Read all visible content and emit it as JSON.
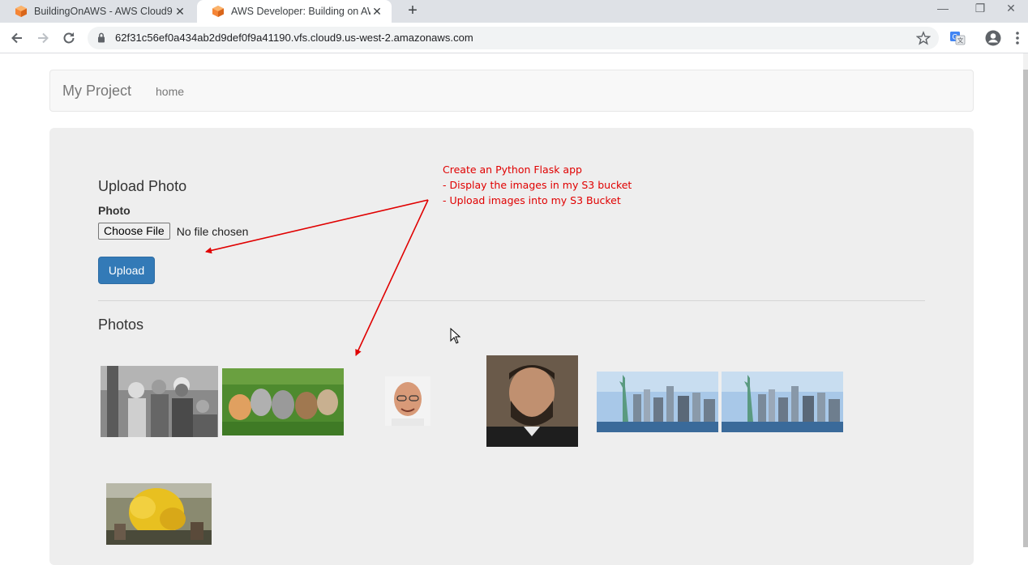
{
  "browser": {
    "tabs": [
      {
        "title": "BuildingOnAWS - AWS Cloud9",
        "active": false
      },
      {
        "title": "AWS Developer: Building on AWS",
        "active": true
      }
    ],
    "new_tab": "+",
    "url": "62f31c56ef0a434ab2d9def0f9a41190.vfs.cloud9.us-west-2.amazonaws.com"
  },
  "navbar": {
    "brand": "My Project",
    "links": [
      "home"
    ]
  },
  "upload": {
    "heading": "Upload Photo",
    "field_label": "Photo",
    "choose_button": "Choose File",
    "no_file": "No file chosen",
    "submit": "Upload"
  },
  "photos": {
    "heading": "Photos",
    "items": [
      {
        "subject": "historic group photo"
      },
      {
        "subject": "kittens on grass"
      },
      {
        "subject": "small portrait"
      },
      {
        "subject": "bearded man portrait"
      },
      {
        "subject": "statue of liberty skyline"
      },
      {
        "subject": "statue of liberty skyline"
      },
      {
        "subject": "yellow autumn tree"
      }
    ]
  },
  "annotation": {
    "line1": "Create an Python Flask app",
    "line2": "- Display the images in my S3 bucket",
    "line3": "- Upload images into my S3 Bucket",
    "color": "#e00000"
  },
  "colors": {
    "primary": "#337ab7",
    "jumbotron": "#eeeeee",
    "aws_orange": "#f58536"
  }
}
